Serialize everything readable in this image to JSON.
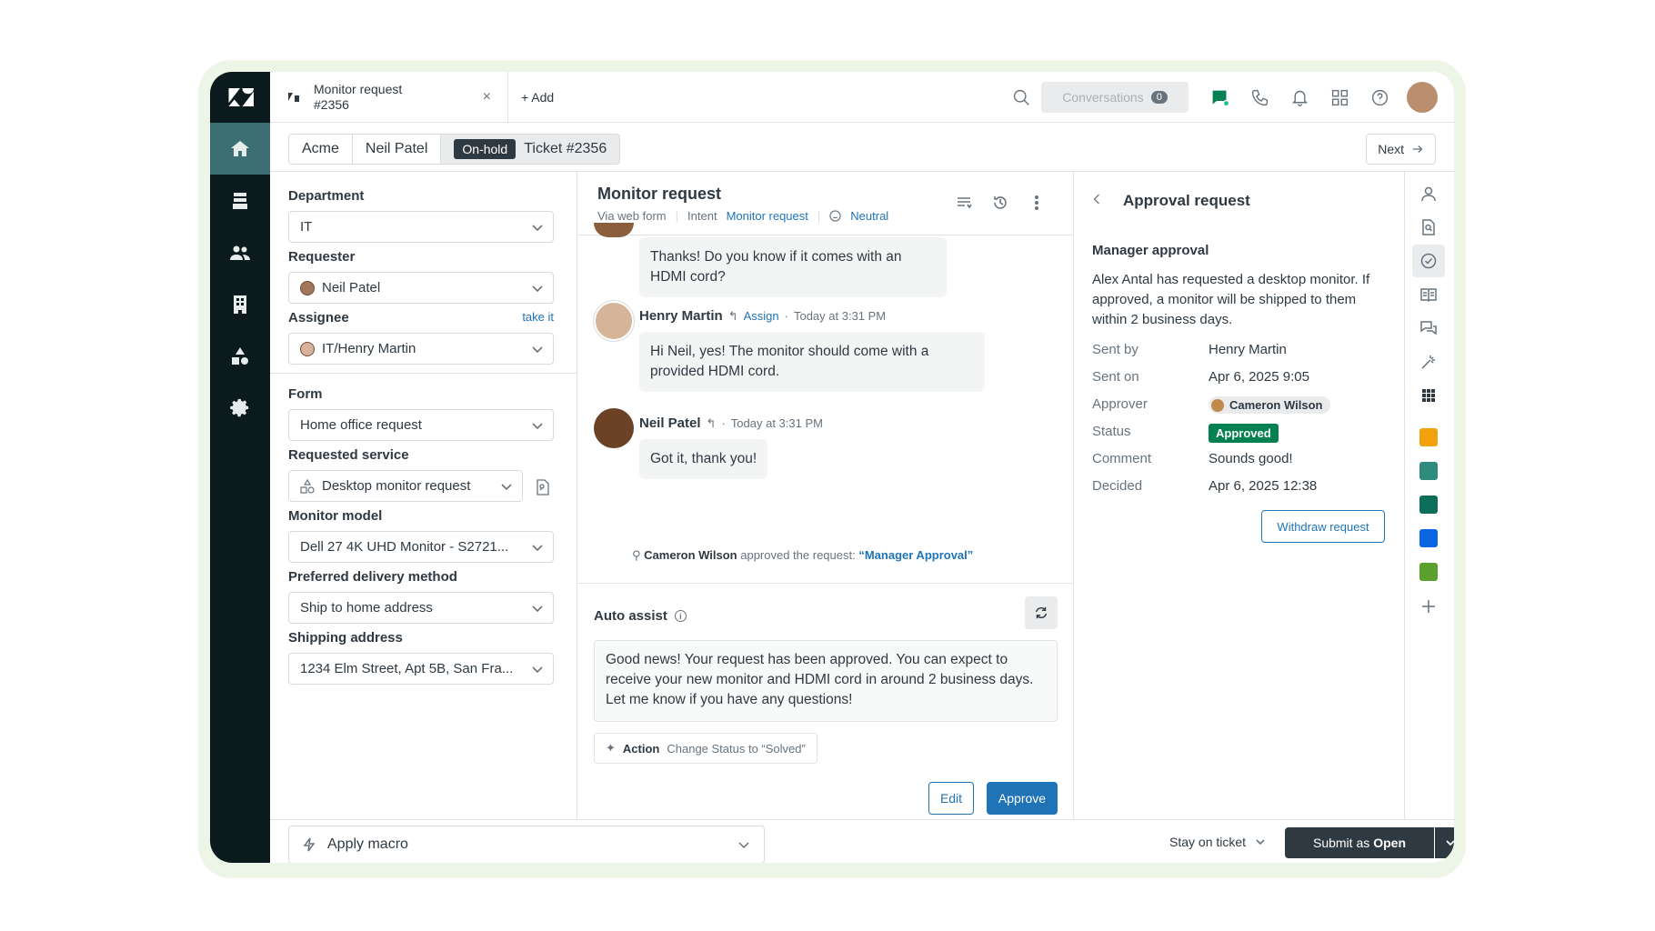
{
  "tab": {
    "title_line1": "Monitor request",
    "title_line2": "#2356",
    "close": "×",
    "add_label": "+ Add"
  },
  "toolbar": {
    "conversations_label": "Conversations",
    "conversations_count": "0"
  },
  "breadcrumb": {
    "org": "Acme",
    "requester": "Neil Patel",
    "status_pill": "On-hold",
    "ticket": "Ticket #2356",
    "next_label": "Next"
  },
  "fields": {
    "department": {
      "label": "Department",
      "value": "IT"
    },
    "requester": {
      "label": "Requester",
      "value": "Neil Patel"
    },
    "assignee": {
      "label": "Assignee",
      "link": "take it",
      "value": "IT/Henry Martin"
    },
    "form": {
      "label": "Form",
      "value": "Home office request"
    },
    "requested_service": {
      "label": "Requested service",
      "value": "Desktop monitor request"
    },
    "monitor_model": {
      "label": "Monitor model",
      "value": "Dell 27 4K UHD Monitor - S2721..."
    },
    "delivery": {
      "label": "Preferred delivery method",
      "value": "Ship to home address"
    },
    "shipping": {
      "label": "Shipping address",
      "value": "1234 Elm Street, Apt 5B, San Fra..."
    }
  },
  "conversation": {
    "title": "Monitor request",
    "via": "Via web form",
    "intent_label": "Intent",
    "intent_value": "Monitor request",
    "sentiment": "Neutral",
    "messages": [
      {
        "text": "Thanks! Do you know if it comes with an HDMI cord?"
      },
      {
        "author": "Henry Martin",
        "assign": "Assign",
        "time": "Today at 3:31 PM",
        "text": "Hi Neil, yes! The monitor should come with a provided HDMI cord."
      },
      {
        "author": "Neil Patel",
        "time": "Today at 3:31 PM",
        "text": "Got it, thank you!"
      }
    ],
    "event": {
      "who": "Cameron Wilson",
      "middle": "approved the request:",
      "what": "“Manager Approval”"
    }
  },
  "auto_assist": {
    "title": "Auto assist",
    "suggestion": "Good news! Your request has been approved. You can expect to receive your new monitor and HDMI cord in around 2 business days. Let me know if you have any questions!",
    "action_label": "Action",
    "action_text": "Change Status to “Solved”",
    "edit": "Edit",
    "approve": "Approve"
  },
  "approval": {
    "title": "Approval request",
    "subtitle": "Manager approval",
    "description": "Alex Antal has requested a desktop monitor. If approved, a monitor will be shipped to them within 2 business days.",
    "rows": [
      {
        "k": "Sent by",
        "v": "Henry Martin"
      },
      {
        "k": "Sent on",
        "v": "Apr 6, 2025 9:05"
      },
      {
        "k": "Approver",
        "v": "Cameron Wilson"
      },
      {
        "k": "Status",
        "v": "Approved"
      },
      {
        "k": "Comment",
        "v": "Sounds good!"
      },
      {
        "k": "Decided",
        "v": "Apr 6, 2025 12:38"
      }
    ],
    "withdraw": "Withdraw request"
  },
  "footer": {
    "macro": "Apply macro",
    "stay": "Stay on ticket",
    "submit_prefix": "Submit as",
    "submit_status": "Open"
  },
  "colors": {
    "accent": "#1f73b7",
    "approved": "#038153",
    "nav_bg": "#0b1a1c",
    "frame": "#ecf5e6"
  }
}
